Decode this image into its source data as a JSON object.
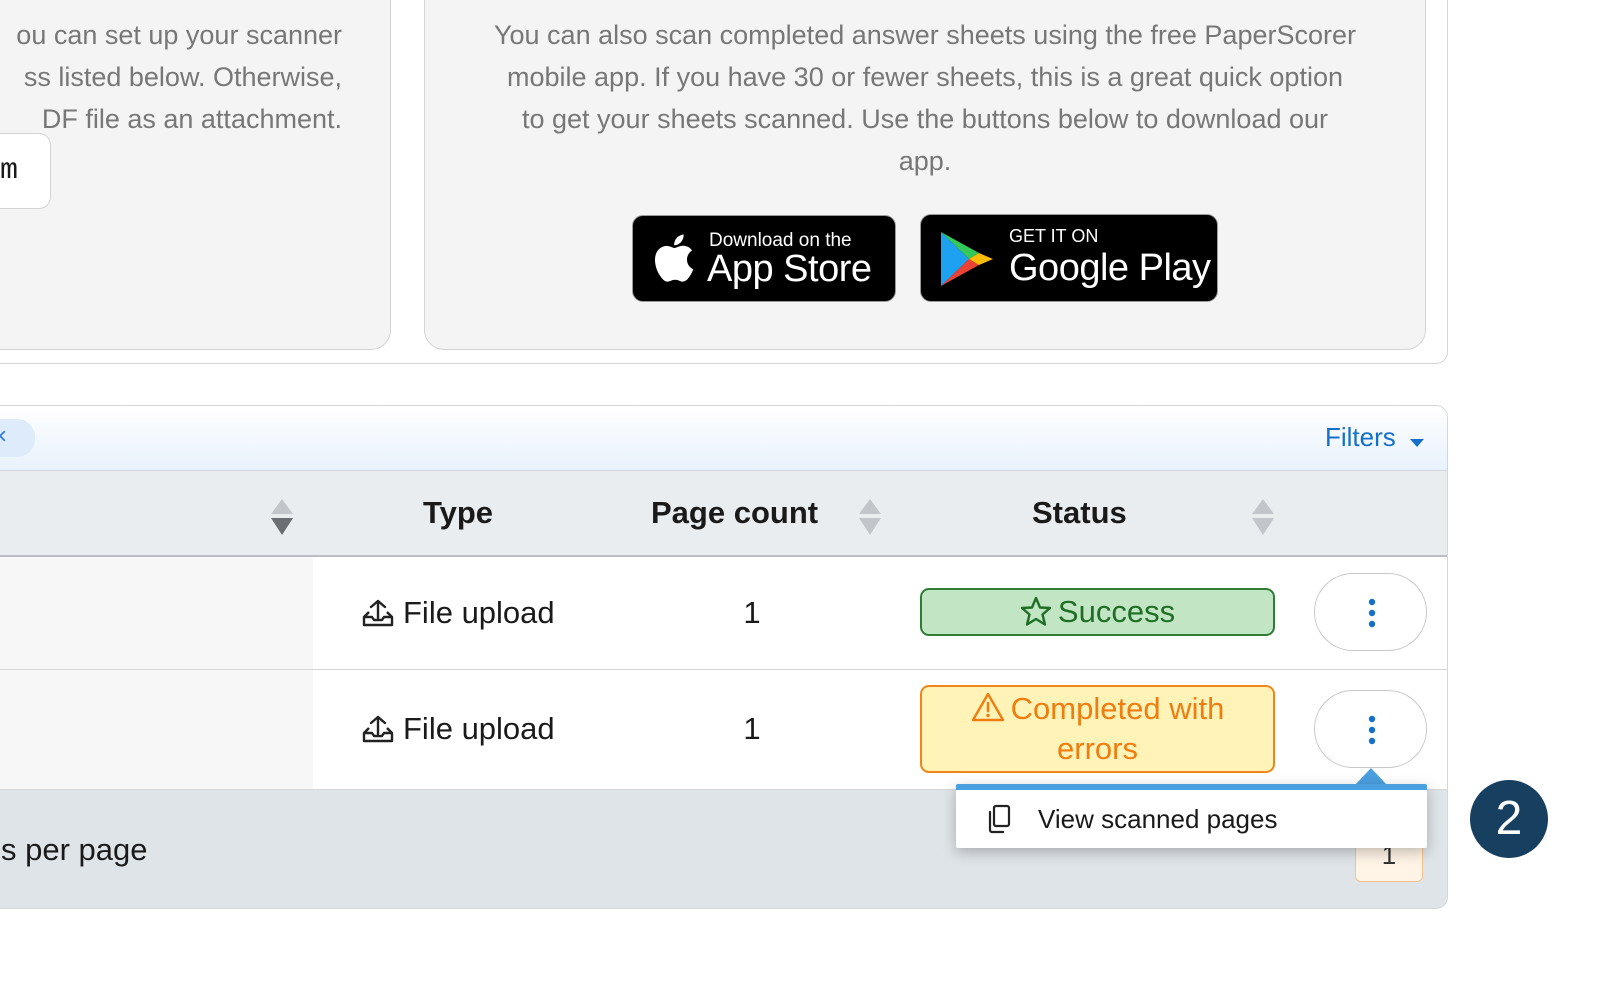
{
  "email_instructions": {
    "lines": [
      "ou can set up your scanner",
      "ss listed below. Otherwise,",
      "DF file as an attachment."
    ],
    "email_partial": "r.com"
  },
  "mobile_app": {
    "lines": [
      "You can also scan completed answer sheets using the free PaperScorer",
      "mobile app. If you have 30 or fewer sheets, this is a great quick option",
      "to get your sheets scanned. Use the buttons below to download our",
      "app."
    ],
    "app_store": {
      "small": "Download on the",
      "big": "App Store",
      "icon": "apple-icon"
    },
    "google_play": {
      "small": "GET IT ON",
      "big": "Google Play",
      "icon": "google-play-icon"
    }
  },
  "filters": {
    "chip_close": "×",
    "label": "Filters"
  },
  "table": {
    "headers": {
      "type": "Type",
      "page_count": "Page count",
      "status": "Status"
    },
    "rows": [
      {
        "type": "File upload",
        "page_count": "1",
        "status": "Success",
        "status_kind": "success"
      },
      {
        "type": "File upload",
        "page_count": "1",
        "status_line1": "Completed with",
        "status_line2": "errors",
        "status_kind": "warning"
      }
    ],
    "footer_text": "s per page",
    "current_page": "1"
  },
  "row_menu": {
    "items": [
      {
        "label": "View scanned pages",
        "icon": "copy-pages-icon"
      }
    ]
  },
  "step_marker": "2",
  "colors": {
    "accent": "#1570c9",
    "success_bg": "#c2e6c4",
    "warning_bg": "#fff3b8",
    "marker": "#173f5f"
  }
}
